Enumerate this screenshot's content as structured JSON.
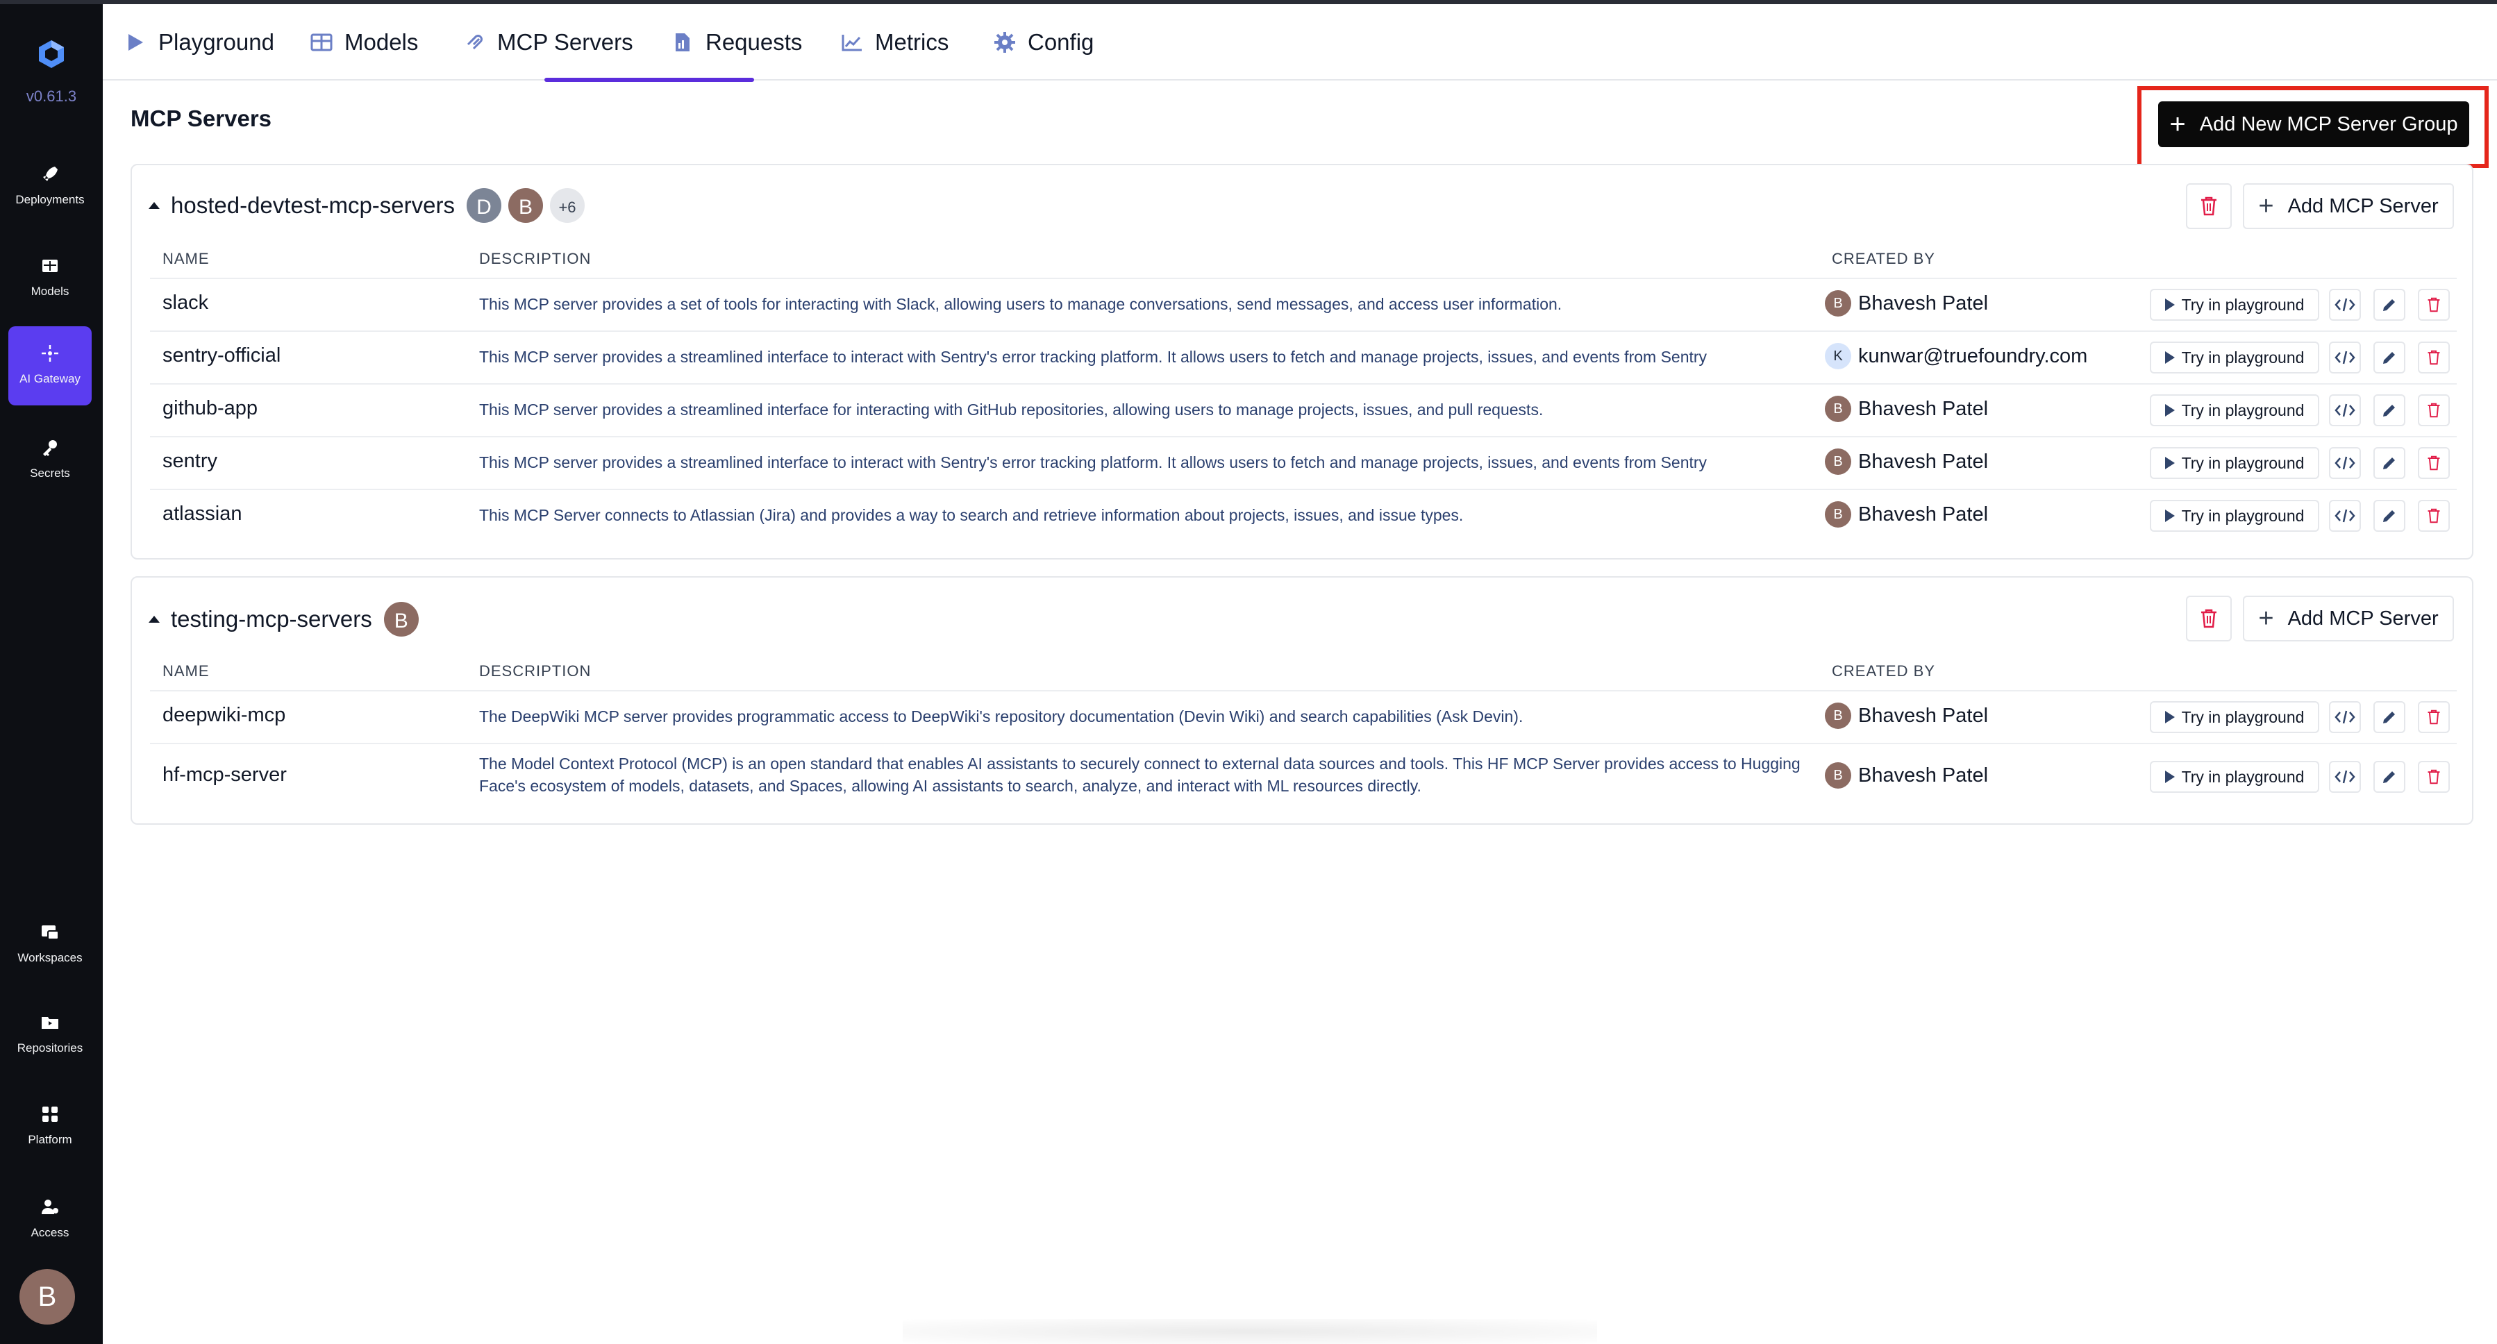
{
  "app": {
    "version": "v0.61.3"
  },
  "sidebar": {
    "items": [
      {
        "label": "Deployments",
        "icon": "rocket-icon"
      },
      {
        "label": "Models",
        "icon": "grid-icon"
      },
      {
        "label": "AI Gateway",
        "icon": "gateway-icon",
        "active": true
      },
      {
        "label": "Secrets",
        "icon": "key-icon"
      },
      {
        "label": "Workspaces",
        "icon": "workspaces-icon"
      },
      {
        "label": "Repositories",
        "icon": "folder-icon"
      },
      {
        "label": "Platform",
        "icon": "platform-icon"
      },
      {
        "label": "Access",
        "icon": "access-icon"
      }
    ],
    "user_initial": "B"
  },
  "topnav": {
    "tabs": [
      {
        "label": "Playground",
        "icon": "play-icon"
      },
      {
        "label": "Models",
        "icon": "table-icon"
      },
      {
        "label": "MCP Servers",
        "icon": "mcp-icon",
        "active": true
      },
      {
        "label": "Requests",
        "icon": "document-icon"
      },
      {
        "label": "Metrics",
        "icon": "chart-icon"
      },
      {
        "label": "Config",
        "icon": "gear-icon"
      }
    ]
  },
  "page": {
    "title": "MCP Servers",
    "add_group_label": "Add New MCP Server Group"
  },
  "columns": {
    "name": "NAME",
    "description": "DESCRIPTION",
    "created_by": "CREATED BY"
  },
  "actions": {
    "try_label": "Try in playground",
    "add_server_label": "Add MCP Server"
  },
  "groups": [
    {
      "name": "hosted-devtest-mcp-servers",
      "avatars": [
        "D",
        "B"
      ],
      "more": "+6",
      "servers": [
        {
          "name": "slack",
          "description": "This MCP server provides a set of tools for interacting with Slack, allowing users to manage conversations, send messages, and access user information.",
          "created_by": "Bhavesh Patel",
          "initial": "B"
        },
        {
          "name": "sentry-official",
          "description": "This MCP server provides a streamlined interface to interact with Sentry's error tracking platform. It allows users to fetch and manage projects, issues, and events from Sentry",
          "created_by": "kunwar@truefoundry.com",
          "initial": "K"
        },
        {
          "name": "github-app",
          "description": "This MCP server provides a streamlined interface for interacting with GitHub repositories, allowing users to manage projects, issues, and pull requests.",
          "created_by": "Bhavesh Patel",
          "initial": "B"
        },
        {
          "name": "sentry",
          "description": "This MCP server provides a streamlined interface to interact with Sentry's error tracking platform. It allows users to fetch and manage projects, issues, and events from Sentry",
          "created_by": "Bhavesh Patel",
          "initial": "B"
        },
        {
          "name": "atlassian",
          "description": "This MCP Server connects to Atlassian (Jira) and provides a way to search and retrieve information about projects, issues, and issue types.",
          "created_by": "Bhavesh Patel",
          "initial": "B"
        }
      ]
    },
    {
      "name": "testing-mcp-servers",
      "avatars": [
        "B"
      ],
      "servers": [
        {
          "name": "deepwiki-mcp",
          "description": "The DeepWiki MCP server provides programmatic access to DeepWiki's repository documentation (Devin Wiki) and search capabilities (Ask Devin).",
          "created_by": "Bhavesh Patel",
          "initial": "B"
        },
        {
          "name": "hf-mcp-server",
          "description": "The Model Context Protocol (MCP) is an open standard that enables AI assistants to securely connect to external data sources and tools. This HF MCP Server provides access to Hugging Face's ecosystem of models, datasets, and Spaces, allowing AI assistants to search, analyze, and interact with ML resources directly.",
          "created_by": "Bhavesh Patel",
          "initial": "B"
        }
      ]
    }
  ],
  "colors": {
    "accent": "#5b3df0",
    "delete": "#e11d48",
    "highlight": "#e5261b",
    "sidebar_bg": "#0d0f14"
  }
}
